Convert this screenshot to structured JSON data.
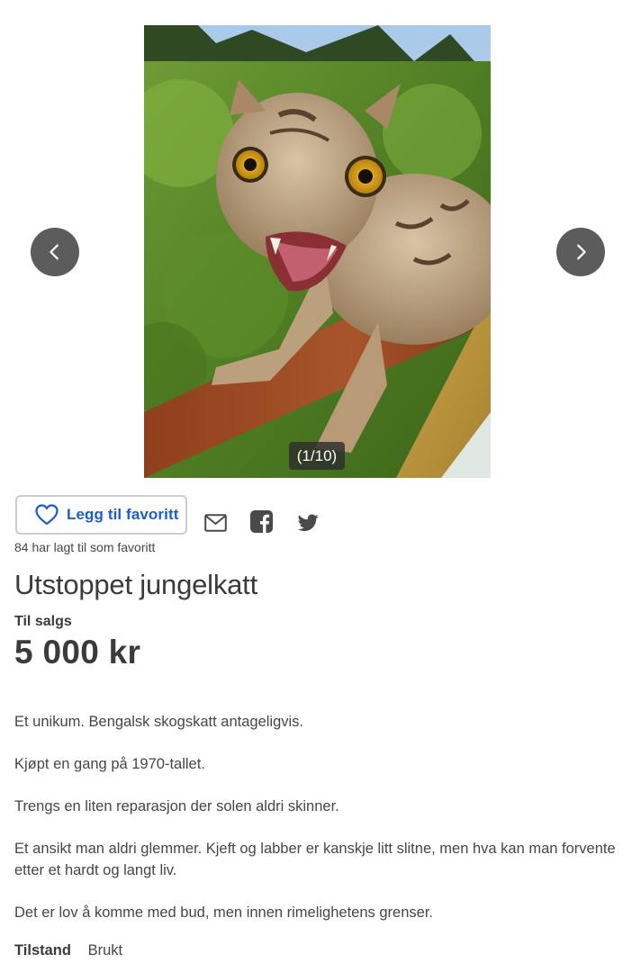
{
  "gallery": {
    "counter": "(1/10)",
    "prev_icon": "chevron-left-icon",
    "next_icon": "chevron-right-icon"
  },
  "actions": {
    "favorite_label": "Legg til favoritt",
    "favorite_count": "84 har lagt til som favoritt",
    "share_icons": [
      "mail-icon",
      "facebook-icon",
      "twitter-icon"
    ]
  },
  "listing": {
    "title": "Utstoppet jungelkatt",
    "sale_type": "Til salgs",
    "price": "5 000 kr",
    "description": [
      "Et unikum. Bengalsk skogskatt antageligvis.",
      "Kjøpt en gang på 1970-tallet.",
      "Trengs en liten reparasjon der solen aldri skinner.",
      "Et ansikt man aldri glemmer. Kjeft og labber er kanskje litt slitne, men hva kan man forvente etter et hardt og langt liv.",
      "Det er lov å komme med bud, men innen rimelighetens grenser."
    ],
    "condition_label": "Tilstand",
    "condition_value": "Brukt"
  },
  "colors": {
    "accent": "#1a5fc8",
    "text": "#464646",
    "nav_button": "#5c5c5c"
  }
}
